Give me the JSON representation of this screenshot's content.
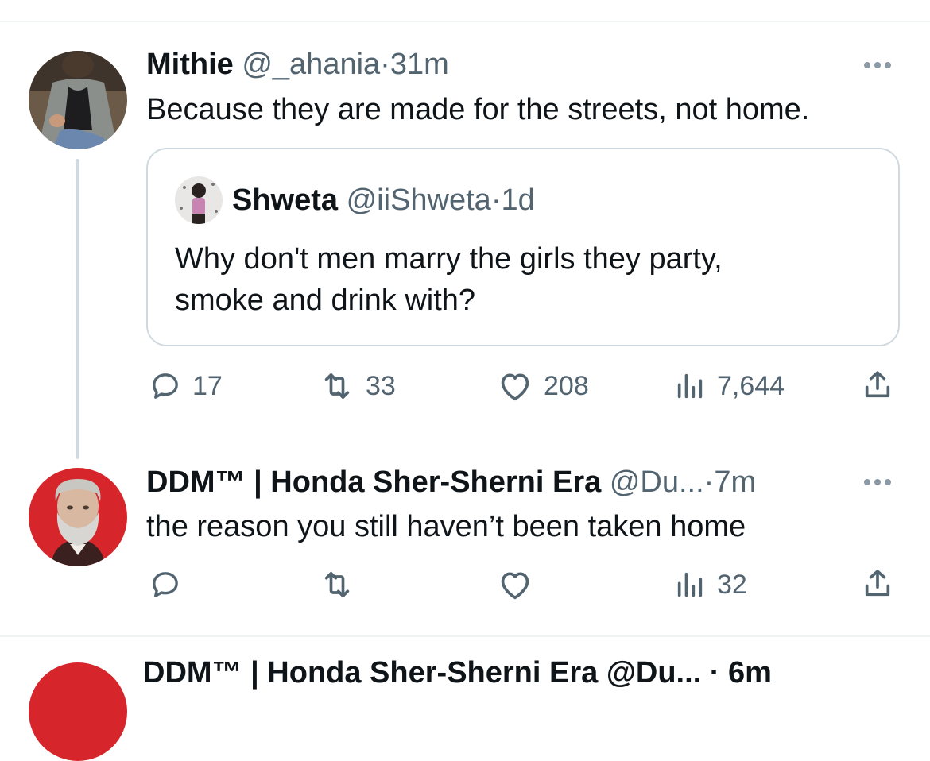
{
  "tweets": [
    {
      "author_name": "Mithie",
      "handle": "@_ahania",
      "separator": "·",
      "time": "31m",
      "text": "Because they are made for the streets, not home.",
      "quoted": {
        "author_name": "Shweta",
        "handle": "@iiShweta",
        "separator": "·",
        "time": "1d",
        "text_line1": "Why don't men marry the girls they party,",
        "text_line2": "smoke and drink with?"
      },
      "actions": {
        "replies": "17",
        "reposts": "33",
        "likes": "208",
        "views": "7,644"
      }
    },
    {
      "author_name": "DDM™ | Honda Sher-Sherni Era",
      "handle": "@Du...",
      "separator": "·",
      "time": "7m",
      "text": "the reason you still haven’t been taken home",
      "actions": {
        "replies": "",
        "reposts": "",
        "likes": "",
        "views": "32"
      }
    }
  ],
  "next_preview": "DDM™ | Honda Sher-Sherni Era @Du... · 6m",
  "colors": {
    "text": "#0f1419",
    "muted": "#536471",
    "border": "#cfd9de",
    "avatar2_bg": "#d7262b"
  },
  "icons": [
    "reply-icon",
    "repost-icon",
    "like-icon",
    "views-icon",
    "share-icon",
    "more-icon"
  ]
}
